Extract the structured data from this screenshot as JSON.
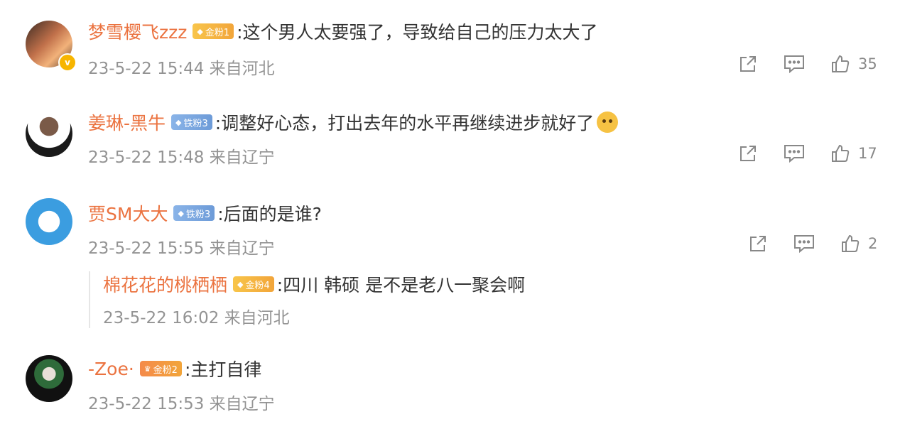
{
  "comments": [
    {
      "username": "梦雪樱飞zzz",
      "badge_label": "金粉1",
      "badge_type": "gold",
      "verified": true,
      "text": ":这个男人太要强了，导致给自己的压力太大了",
      "time": "23-5-22 15:44",
      "location": "来自河北",
      "likes": "35"
    },
    {
      "username": "姜琳-黑牛",
      "badge_label": "铁粉3",
      "badge_type": "iron",
      "text": ":调整好心态，打出去年的水平再继续进步就好了",
      "emoji": "doge-emoji",
      "time": "23-5-22 15:48",
      "location": "来自辽宁",
      "likes": "17"
    },
    {
      "username": "贾SM大大",
      "badge_label": "铁粉3",
      "badge_type": "iron",
      "text": ":后面的是谁?",
      "time": "23-5-22 15:55",
      "location": "来自辽宁",
      "likes": "2",
      "reply": {
        "username": "棉花花的桃栖栖",
        "badge_label": "金粉4",
        "badge_type": "gold",
        "text": ":四川 韩硕  是不是老八一聚会啊",
        "time": "23-5-22 16:02",
        "location": "来自河北"
      }
    },
    {
      "username": "-Zoe·",
      "badge_label": "金粉2",
      "badge_type": "gold",
      "text": ":主打自律",
      "time": "23-5-22 15:53",
      "location": "来自辽宁"
    }
  ],
  "icons": {
    "share": "share-icon",
    "comment": "comment-icon",
    "like": "thumbs-up-icon"
  },
  "colors": {
    "username": "#eb7340",
    "meta": "#939393",
    "gold_badge": "#f3ad3c",
    "iron_badge": "#7aa8e0"
  }
}
